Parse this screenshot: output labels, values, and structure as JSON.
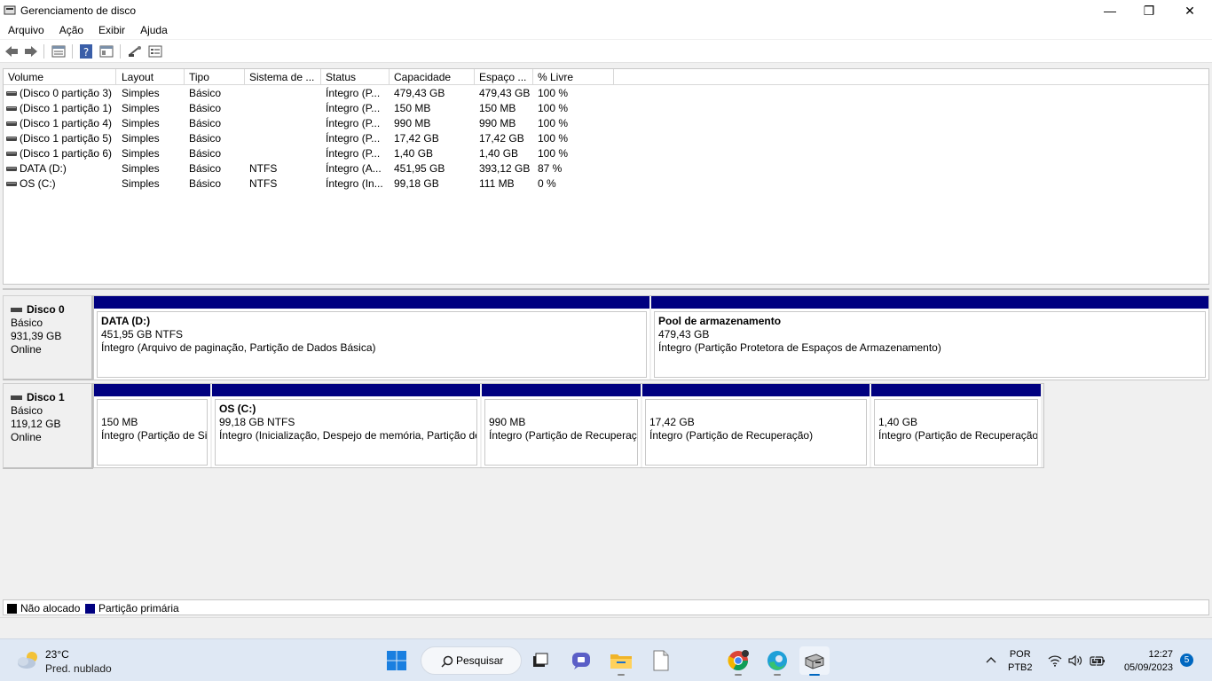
{
  "window": {
    "title": "Gerenciamento de disco",
    "controls": {
      "minimize": "—",
      "maximize": "❐",
      "close": "✕"
    }
  },
  "menu": [
    "Arquivo",
    "Ação",
    "Exibir",
    "Ajuda"
  ],
  "toolbar": [
    "back-icon",
    "forward-icon",
    "properties-list-icon",
    "help-icon",
    "details-icon",
    "connect-icon",
    "disk-settings-icon"
  ],
  "volume_list": {
    "columns": [
      "Volume",
      "Layout",
      "Tipo",
      "Sistema de ...",
      "Status",
      "Capacidade",
      "Espaço ...",
      "% Livre"
    ],
    "rows": [
      [
        "(Disco 0 partição 3)",
        "Simples",
        "Básico",
        "",
        "Íntegro (P...",
        "479,43 GB",
        "479,43 GB",
        "100 %"
      ],
      [
        "(Disco 1 partição 1)",
        "Simples",
        "Básico",
        "",
        "Íntegro (P...",
        "150 MB",
        "150 MB",
        "100 %"
      ],
      [
        "(Disco 1 partição 4)",
        "Simples",
        "Básico",
        "",
        "Íntegro (P...",
        "990 MB",
        "990 MB",
        "100 %"
      ],
      [
        "(Disco 1 partição 5)",
        "Simples",
        "Básico",
        "",
        "Íntegro (P...",
        "17,42 GB",
        "17,42 GB",
        "100 %"
      ],
      [
        "(Disco 1 partição 6)",
        "Simples",
        "Básico",
        "",
        "Íntegro (P...",
        "1,40 GB",
        "1,40 GB",
        "100 %"
      ],
      [
        "DATA (D:)",
        "Simples",
        "Básico",
        "NTFS",
        "Íntegro (A...",
        "451,95 GB",
        "393,12 GB",
        "87 %"
      ],
      [
        "OS (C:)",
        "Simples",
        "Básico",
        "NTFS",
        "Íntegro (In...",
        "99,18 GB",
        "111 MB",
        "0 %"
      ]
    ]
  },
  "disks": [
    {
      "name": "Disco 0",
      "type": "Básico",
      "size": "931,39 GB",
      "state": "Online",
      "partitions": [
        {
          "title": "DATA  (D:)",
          "size": "451,95 GB NTFS",
          "status": "Íntegro (Arquivo de paginação, Partição de Dados Básica)"
        },
        {
          "title": "Pool de armazenamento",
          "size": "479,43 GB",
          "status": "Íntegro (Partição Protetora de Espaços de Armazenamento)"
        }
      ]
    },
    {
      "name": "Disco 1",
      "type": "Básico",
      "size": "119,12 GB",
      "state": "Online",
      "partitions": [
        {
          "title": "",
          "size": "150 MB",
          "status": "Íntegro (Partição de Si"
        },
        {
          "title": "OS  (C:)",
          "size": "99,18 GB NTFS",
          "status": "Íntegro (Inicialização, Despejo de memória, Partição de"
        },
        {
          "title": "",
          "size": "990 MB",
          "status": "Íntegro (Partição de Recuperaç"
        },
        {
          "title": "",
          "size": "17,42 GB",
          "status": "Íntegro (Partição de Recuperação)"
        },
        {
          "title": "",
          "size": "1,40 GB",
          "status": "Íntegro (Partição de Recuperação)"
        }
      ]
    }
  ],
  "legend": [
    {
      "label": "Não alocado",
      "color": "#000000"
    },
    {
      "label": "Partição primária",
      "color": "#000080"
    }
  ],
  "taskbar": {
    "weather": {
      "temp": "23°C",
      "desc": "Pred. nublado",
      "icon": "partly-cloudy-icon"
    },
    "search_label": "Pesquisar",
    "apps": [
      "start-icon",
      "task-view-icon",
      "teams-chat-icon",
      "file-explorer-icon",
      "notepad-icon",
      "chrome-icon",
      "edge-icon",
      "disk-management-icon"
    ],
    "tray": {
      "lang": "POR",
      "layout": "PTB2",
      "time": "12:27",
      "date": "05/09/2023",
      "notifications": "5"
    }
  }
}
